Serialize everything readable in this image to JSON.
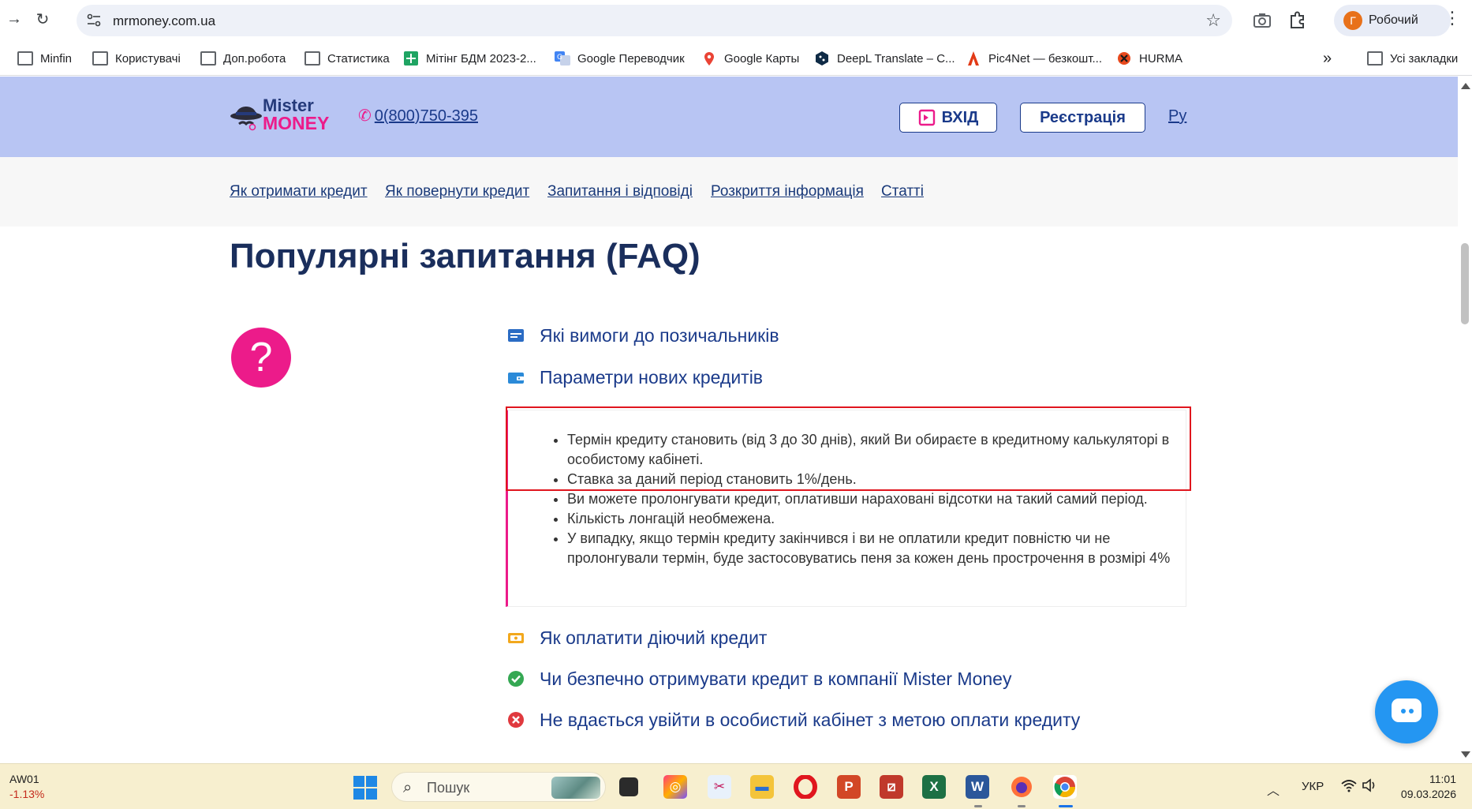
{
  "browser": {
    "url": "mrmoney.com.ua",
    "profile_initial": "Г",
    "profile_name": "Робочий"
  },
  "bookmarks": [
    {
      "label": "Minfin",
      "icon": "folder-icon"
    },
    {
      "label": "Користувачі",
      "icon": "folder-icon"
    },
    {
      "label": "Доп.робота",
      "icon": "folder-icon"
    },
    {
      "label": "Статистика",
      "icon": "folder-icon"
    },
    {
      "label": "Мітінг БДМ 2023-2...",
      "icon": "sheets-icon"
    },
    {
      "label": "Google Переводчик",
      "icon": "translate-icon"
    },
    {
      "label": "Google Карты",
      "icon": "maps-icon"
    },
    {
      "label": "DeepL Translate – C...",
      "icon": "deepl-icon"
    },
    {
      "label": "Pic4Net — безкошт...",
      "icon": "pic4net-icon"
    },
    {
      "label": "HURMA",
      "icon": "hurma-icon"
    }
  ],
  "bookmarks_more": "»",
  "bookmarks_all": "Усі закладки",
  "site": {
    "logo_line1": "Mister",
    "logo_line2": "MONEY",
    "phone": "0(800)750-395",
    "login_label": "ВХІД",
    "register_label": "Реєстрація",
    "lang_label": "Ру",
    "brand_pink": "#ec1b8a",
    "brand_navy": "#1a3a8a",
    "header_bg": "#b8c5f3"
  },
  "nav": [
    "Як отримати кредит",
    "Як повернути кредит",
    "Запитання і відповіді",
    "Розкриття інформація",
    "Статті"
  ],
  "faq": {
    "title": "Популярні запитання (FAQ)",
    "circle_symbol": "?",
    "items": [
      {
        "label": "Які вимоги до позичальників",
        "icon": "id-card-icon"
      },
      {
        "label": "Параметри нових кредитів",
        "icon": "wallet-icon"
      },
      {
        "label": "Як оплатити діючий кредит",
        "icon": "cash-icon"
      },
      {
        "label": "Чи безпечно отримувати кредит в компанії Mister Money",
        "icon": "check-circle-icon"
      },
      {
        "label": "Не вдається увійти в особистий кабінет з метою оплати кредиту",
        "icon": "error-circle-icon"
      }
    ],
    "answer": [
      "Термін кредиту становить (від 3 до 30 днів), який Ви обираєте в кредитному калькуляторі в особистому кабінеті.",
      "Ставка за даний період становить 1%/день.",
      "Ви можете пролонгувати кредит, оплативши нараховані відсотки на такий самий період.",
      "Кількість лонгацій необмежена.",
      "У випадку, якщо термін кредиту закінчився і ви не оплатили кредит повністю чи не пролонгували термін, буде застосовуватись пеня за кожен день прострочення в розмірі 4%"
    ]
  },
  "taskbar": {
    "stock_name": "AW01",
    "stock_change": "-1.13%",
    "search_placeholder": "Пошук",
    "lang": "УКР",
    "time": "11:01",
    "date": "09.03.2026"
  }
}
